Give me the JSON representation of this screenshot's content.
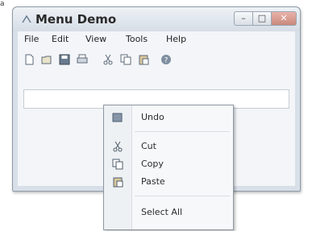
{
  "mark_label": "a",
  "window": {
    "title": "Menu Demo",
    "controls": {
      "minimize": "–",
      "maximize": "□",
      "close": "✕"
    }
  },
  "menubar": {
    "items": [
      "File",
      "Edit",
      "View",
      "Tools",
      "Help"
    ]
  },
  "toolbar": {
    "icons": [
      "new-icon",
      "open-icon",
      "save-icon",
      "print-icon",
      "cut-icon",
      "copy-icon",
      "paste-icon",
      "help-icon"
    ]
  },
  "context_menu": {
    "items": [
      {
        "label": "Undo",
        "icon": "undo-icon"
      },
      {
        "label": "Cut",
        "icon": "cut-icon"
      },
      {
        "label": "Copy",
        "icon": "copy-icon"
      },
      {
        "label": "Paste",
        "icon": "paste-icon"
      },
      {
        "label": "Select All",
        "icon": ""
      }
    ]
  },
  "colors": {
    "frame": "#d8dfe8",
    "client": "#f3f5f8",
    "menu_bg": "#f7f8fa",
    "close_btn": "#c8887c"
  }
}
